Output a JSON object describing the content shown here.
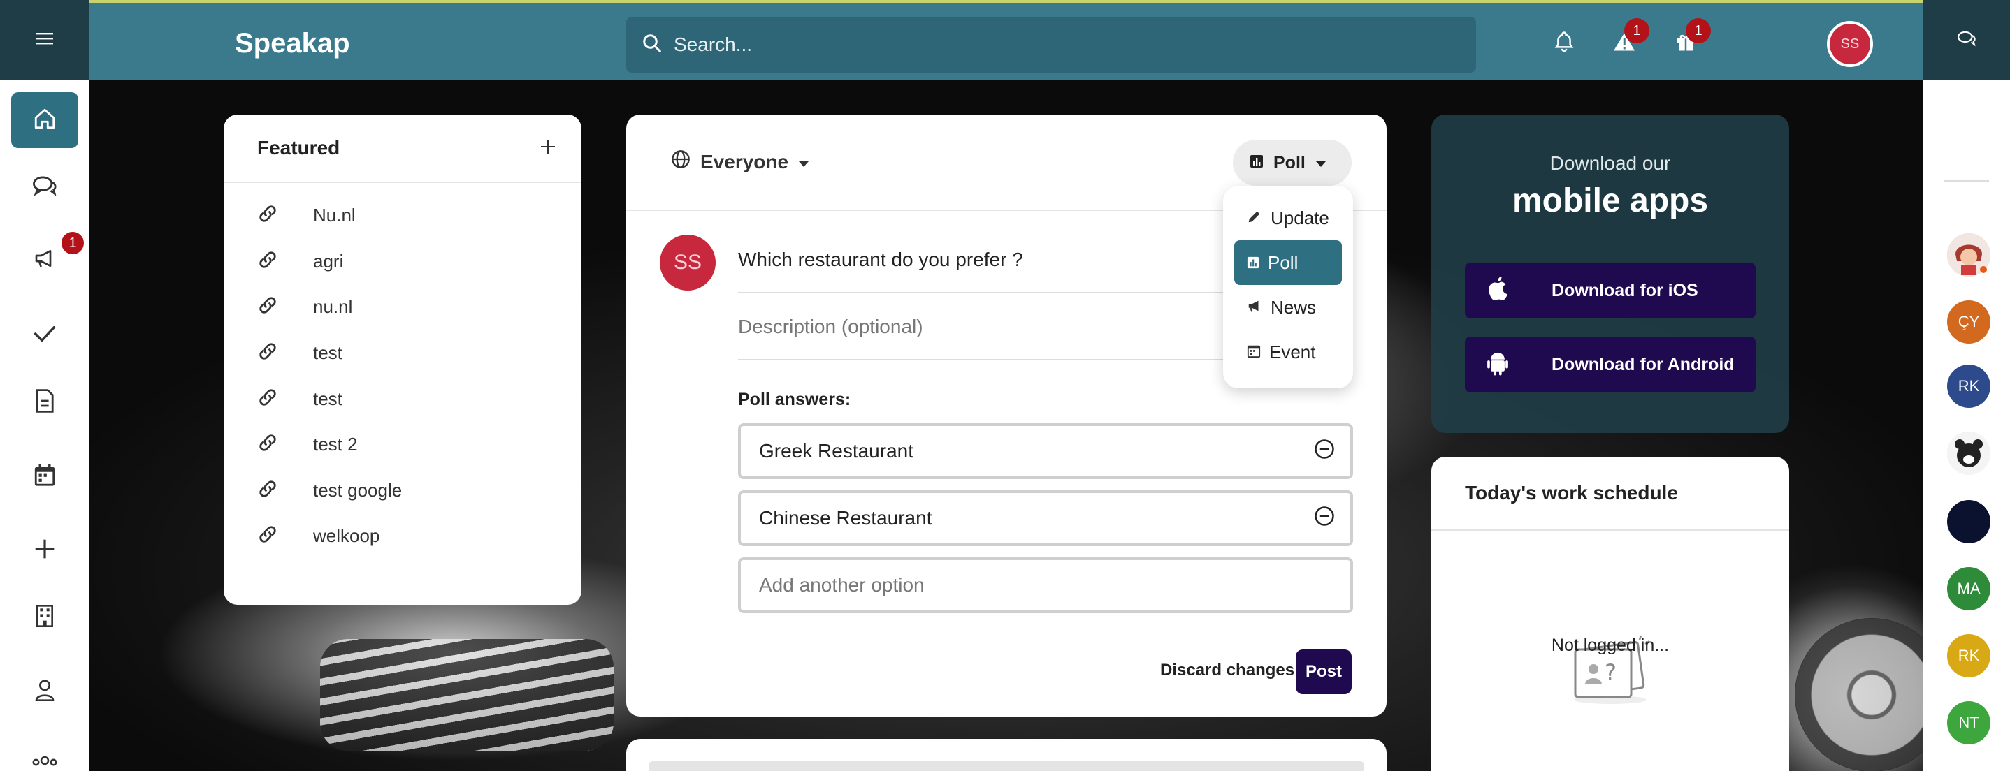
{
  "app": {
    "name": "Speakap"
  },
  "search": {
    "placeholder": "Search..."
  },
  "topbar": {
    "icons": [
      {
        "name": "bell-icon",
        "badge": ""
      },
      {
        "name": "alert-icon",
        "badge": "1"
      },
      {
        "name": "gift-icon",
        "badge": "1"
      }
    ],
    "user_initials": "SS"
  },
  "left_nav": {
    "items": [
      {
        "name": "home",
        "active": true,
        "badge": ""
      },
      {
        "name": "chats",
        "active": false,
        "badge": ""
      },
      {
        "name": "announcements",
        "active": false,
        "badge": "1"
      },
      {
        "name": "tasks",
        "active": false,
        "badge": ""
      },
      {
        "name": "documents",
        "active": false,
        "badge": ""
      },
      {
        "name": "calendar",
        "active": false,
        "badge": ""
      },
      {
        "name": "add",
        "active": false,
        "badge": ""
      },
      {
        "name": "building",
        "active": false,
        "badge": ""
      },
      {
        "name": "profile",
        "active": false,
        "badge": ""
      },
      {
        "name": "groups",
        "active": false,
        "badge": ""
      }
    ]
  },
  "featured": {
    "title": "Featured",
    "links": [
      "Nu.nl",
      "agri",
      "nu.nl",
      "test",
      "test",
      "test 2",
      "test google",
      "welkoop"
    ]
  },
  "composer": {
    "audience": "Everyone",
    "type_selected": "Poll",
    "author_initials": "SS",
    "question": "Which restaurant do you prefer ?",
    "description_placeholder": "Description (optional)",
    "poll_label": "Poll answers:",
    "answers": [
      "Greek Restaurant",
      "Chinese Restaurant"
    ],
    "add_option_placeholder": "Add another option",
    "discard_label": "Discard changes",
    "post_label": "Post"
  },
  "type_dropdown": {
    "options": [
      {
        "label": "Update",
        "icon": "pencil-icon",
        "selected": false
      },
      {
        "label": "Poll",
        "icon": "poll-icon",
        "selected": true
      },
      {
        "label": "News",
        "icon": "megaphone-icon",
        "selected": false
      },
      {
        "label": "Event",
        "icon": "calendar-icon",
        "selected": false
      }
    ]
  },
  "mobile_apps": {
    "subtitle": "Download our",
    "title": "mobile apps",
    "ios_label": "Download for iOS",
    "android_label": "Download for Android"
  },
  "schedule": {
    "title": "Today's work schedule",
    "empty_text": "Not logged in..."
  },
  "right_rail": {
    "contacts": [
      {
        "initials": "",
        "color": "#d9b3a6",
        "type": "photo"
      },
      {
        "initials": "ÇY",
        "color": "#d2691e",
        "type": "initials"
      },
      {
        "initials": "RK",
        "color": "#2c4a8c",
        "type": "initials"
      },
      {
        "initials": "",
        "color": "#e8e8e8",
        "type": "photo"
      },
      {
        "initials": "",
        "color": "#0b1230",
        "type": "photo"
      },
      {
        "initials": "MA",
        "color": "#2e8b3a",
        "type": "initials"
      },
      {
        "initials": "RK",
        "color": "#d8a815",
        "type": "initials"
      },
      {
        "initials": "NT",
        "color": "#3da63d",
        "type": "initials"
      }
    ]
  },
  "colors": {
    "topbar": "#3b7a8c",
    "dark_teal": "#1f3d46",
    "accent_active": "#2f6f82",
    "primary_button": "#1f0a4f",
    "badge": "#b31218",
    "avatar": "#c8283e"
  }
}
